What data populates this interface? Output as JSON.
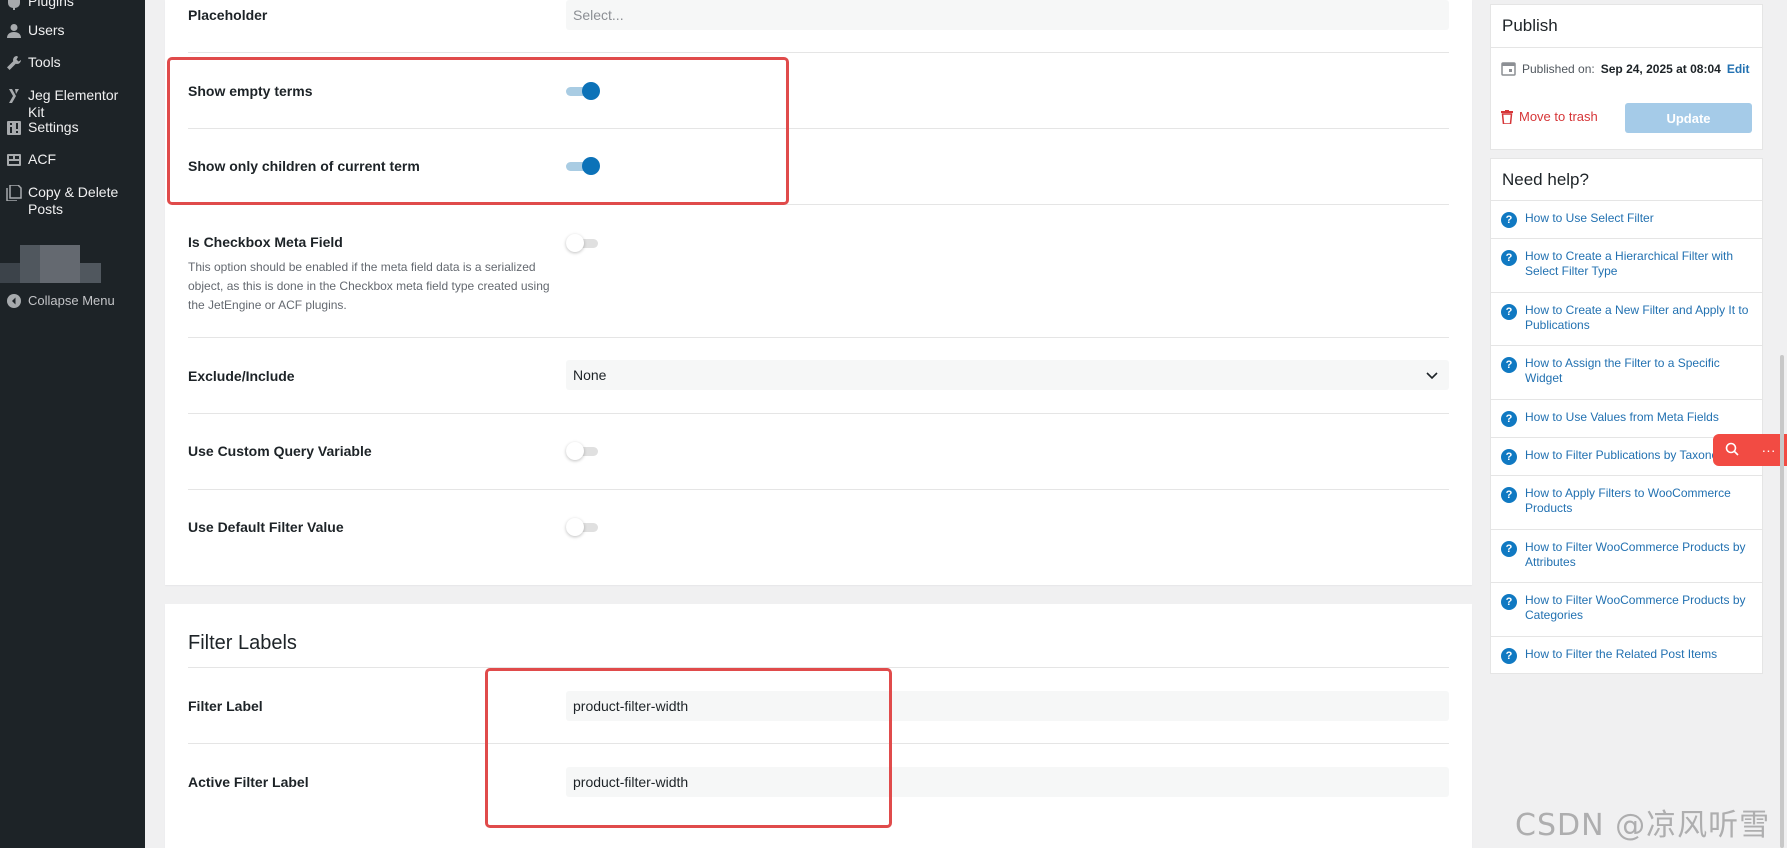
{
  "sidebar": {
    "items": [
      {
        "label": "Plugins",
        "icon": "plugins-icon"
      },
      {
        "label": "Users",
        "icon": "users-icon"
      },
      {
        "label": "Tools",
        "icon": "tools-icon"
      },
      {
        "label": "Jeg Elementor Kit",
        "icon": "jeg-kit-icon"
      },
      {
        "label": "Settings",
        "icon": "settings-icon"
      },
      {
        "label": "ACF",
        "icon": "acf-icon"
      },
      {
        "label": "Copy & Delete Posts",
        "icon": "copy-delete-icon"
      }
    ],
    "collapse_label": "Collapse Menu"
  },
  "settings": {
    "placeholder": {
      "label": "Placeholder",
      "value": "Select..."
    },
    "show_empty_terms": {
      "label": "Show empty terms",
      "enabled": true
    },
    "show_only_children": {
      "label": "Show only children of current term",
      "enabled": true
    },
    "is_checkbox_meta": {
      "label": "Is Checkbox Meta Field",
      "description": "This option should be enabled if the meta field data is a serialized object, as this is done in the Checkbox meta field type created using the JetEngine or ACF plugins.",
      "enabled": false
    },
    "exclude_include": {
      "label": "Exclude/Include",
      "value": "None"
    },
    "custom_query_var": {
      "label": "Use Custom Query Variable",
      "enabled": false
    },
    "default_filter_value": {
      "label": "Use Default Filter Value",
      "enabled": false
    }
  },
  "filter_labels": {
    "title": "Filter Labels",
    "filter_label": {
      "label": "Filter Label",
      "value": "product-filter-width"
    },
    "active_filter_label": {
      "label": "Active Filter Label",
      "value": "product-filter-width"
    }
  },
  "publish": {
    "title": "Publish",
    "published_prefix": "Published on:",
    "published_date": "Sep 24, 2025 at 08:04",
    "edit_label": "Edit",
    "trash_label": "Move to trash",
    "update_label": "Update"
  },
  "help": {
    "title": "Need help?",
    "links": [
      "How to Use Select Filter",
      "How to Create a Hierarchical Filter with Select Filter Type",
      "How to Create a New Filter and Apply It to Publications",
      "How to Assign the Filter to a Specific Widget",
      "How to Use Values from Meta Fields",
      "How to Filter Publications by Taxonomies",
      "How to Apply Filters to WooCommerce Products",
      "How to Filter WooCommerce Products by Attributes",
      "How to Filter WooCommerce Products by Categories",
      "How to Filter the Related Post Items"
    ]
  },
  "watermark": "CSDN @凉风听雪",
  "colors": {
    "accent": "#0c72b8",
    "highlight": "#e04b4b",
    "sidebar": "#1d2327"
  }
}
